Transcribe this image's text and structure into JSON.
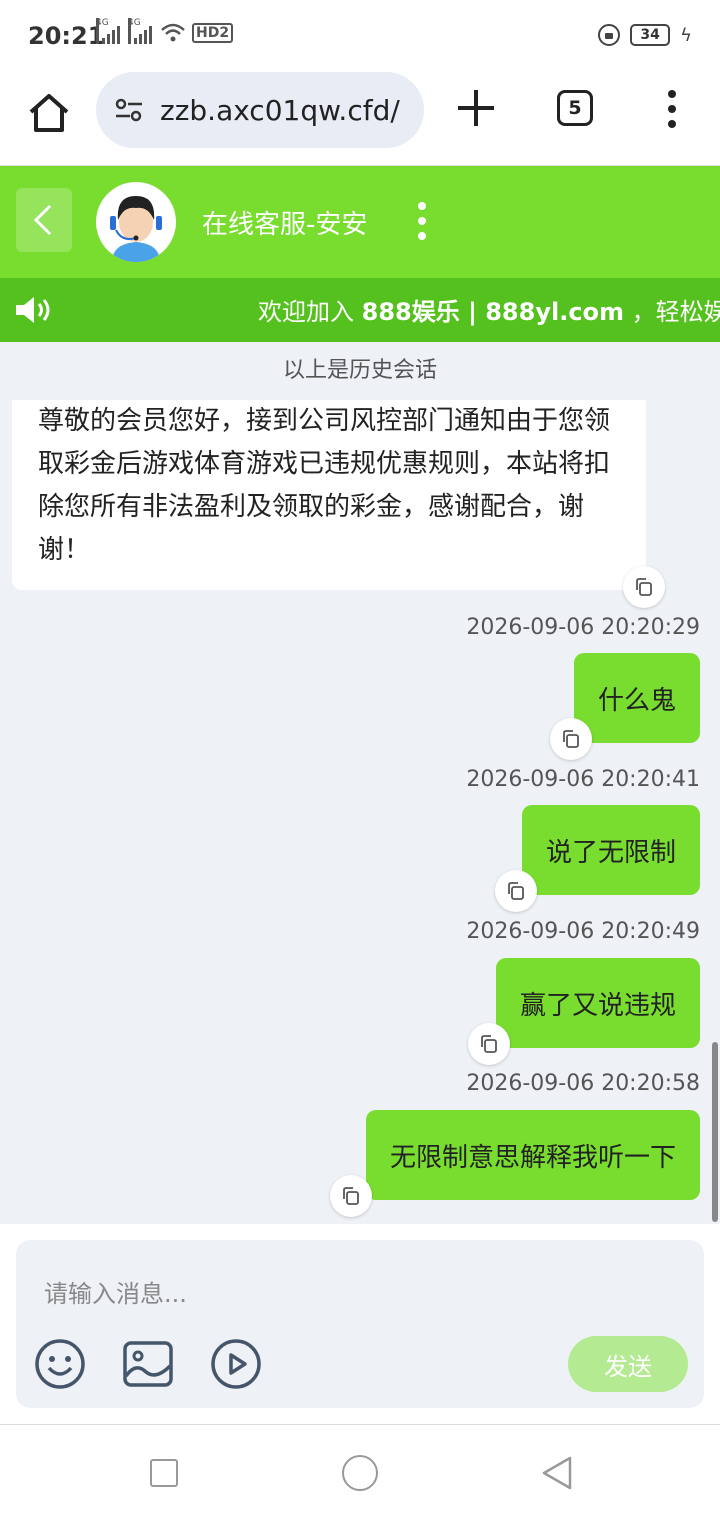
{
  "status_bar": {
    "time": "20:21",
    "network_1": "4G",
    "network_2": "4G",
    "hd_label": "HD2",
    "battery": "34"
  },
  "browser": {
    "url": "zzb.axc01qw.cfd/",
    "tab_count": "5"
  },
  "chat_header": {
    "agent_name": "在线客服-安安"
  },
  "notice": {
    "prefix": "欢迎加入 ",
    "brand": "888娱乐",
    "separator": " | ",
    "domain": "888yl.com",
    "suffix": " ，轻松娱乐"
  },
  "chat": {
    "history_label": "以上是历史会话",
    "received_message": "尊敬的会员您好，接到公司风控部门通知由于您领取彩金后游戏体育游戏已违规优惠规则，本站将扣除您所有非法盈利及领取的彩金，感谢配合，谢谢！",
    "sent_messages": [
      {
        "timestamp": "2026-09-06 20:20:29",
        "text": "什么鬼"
      },
      {
        "timestamp": "2026-09-06 20:20:41",
        "text": "说了无限制"
      },
      {
        "timestamp": "2026-09-06 20:20:49",
        "text": "赢了又说违规"
      },
      {
        "timestamp": "2026-09-06 20:20:58",
        "text": "无限制意思解释我听一下"
      }
    ]
  },
  "composer": {
    "placeholder": "请输入消息...",
    "send_label": "发送"
  },
  "colors": {
    "header_green": "#79dd2f",
    "notice_green": "#55c11f",
    "chat_bg": "#eef1f6",
    "send_disabled": "#b4ea92"
  }
}
